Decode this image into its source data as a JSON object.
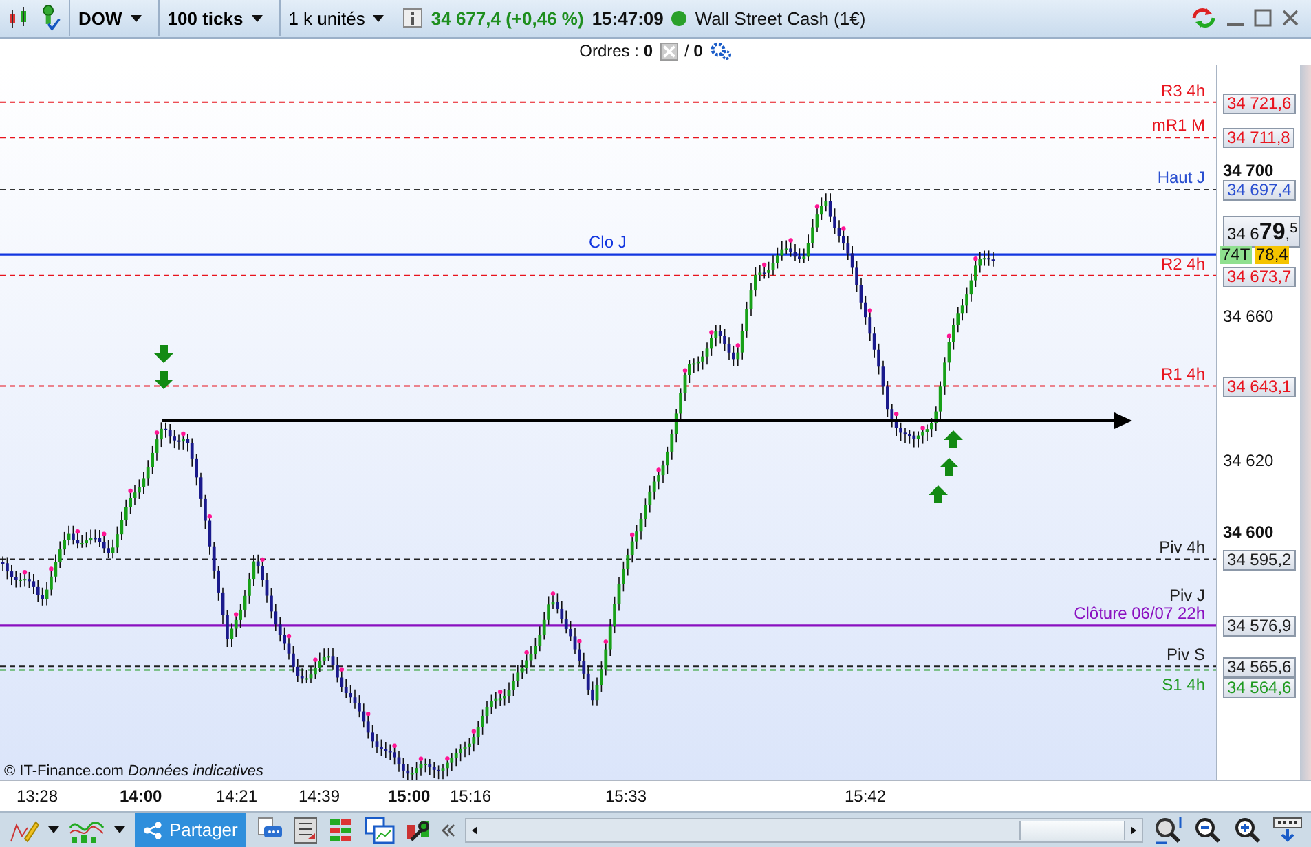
{
  "toolbar": {
    "symbol": "DOW",
    "interval": "100 ticks",
    "size": "1 k unités",
    "quote": "34 677,4 (+0,46 %)",
    "time": "15:47:09",
    "market_open": true,
    "instrument": "Wall Street Cash (1€)"
  },
  "orders": {
    "text": "Ordres : **0**",
    "pending": "/ **0**"
  },
  "chart": {
    "levels": [
      {
        "label": "R3 4h",
        "value": "34 721,6",
        "color": "#e8141e",
        "kind": "level"
      },
      {
        "label": "mR1 M",
        "value": "34 711,8",
        "color": "#e8141e",
        "kind": "level"
      },
      {
        "label": "Haut J",
        "value": "34 697,4",
        "color": "#2a4fd0",
        "kind": "level"
      },
      {
        "label": "Clo J",
        "color": "#1236e0",
        "kind": "reference"
      },
      {
        "label": "R2 4h",
        "value": "34 673,7",
        "color": "#e8141e",
        "kind": "level"
      },
      {
        "label": "R1 4h",
        "value": "34 643,1",
        "color": "#e8141e",
        "kind": "level"
      },
      {
        "label": "Piv 4h",
        "value": "34 595,2",
        "color": "#222222",
        "kind": "level"
      },
      {
        "label": "Piv J",
        "color": "#222222",
        "kind": "label"
      },
      {
        "label": "Clôture 06/07 22h",
        "value": "34 576,9",
        "color": "#8a10c0",
        "kind": "close"
      },
      {
        "label": "Piv S",
        "value": "34 565,6",
        "color": "#222222",
        "kind": "level"
      },
      {
        "label": "S1 4h",
        "value": "34 564,6",
        "color": "#1f9a1f",
        "kind": "level"
      }
    ],
    "price_ticks": [
      {
        "label": "34 700",
        "major": true
      },
      {
        "label": "34 660",
        "major": false
      },
      {
        "label": "34 620",
        "major": false
      },
      {
        "label": "34 600",
        "major": true
      }
    ],
    "last_price": "34 6**79**,$^{5}$",
    "tick_count": "74T",
    "bid": "78,4",
    "copyright": "© IT-Finance.com *Données indicatives*"
  },
  "time_axis": [
    {
      "label": "13:28",
      "major": false
    },
    {
      "label": "14:00",
      "major": true
    },
    {
      "label": "14:21",
      "major": false
    },
    {
      "label": "14:39",
      "major": false
    },
    {
      "label": "15:00",
      "major": true
    },
    {
      "label": "15:16",
      "major": false
    },
    {
      "label": "15:33",
      "major": false
    },
    {
      "label": "15:42",
      "major": false
    }
  ],
  "bottom_toolbar": {
    "share": "Partager"
  }
}
